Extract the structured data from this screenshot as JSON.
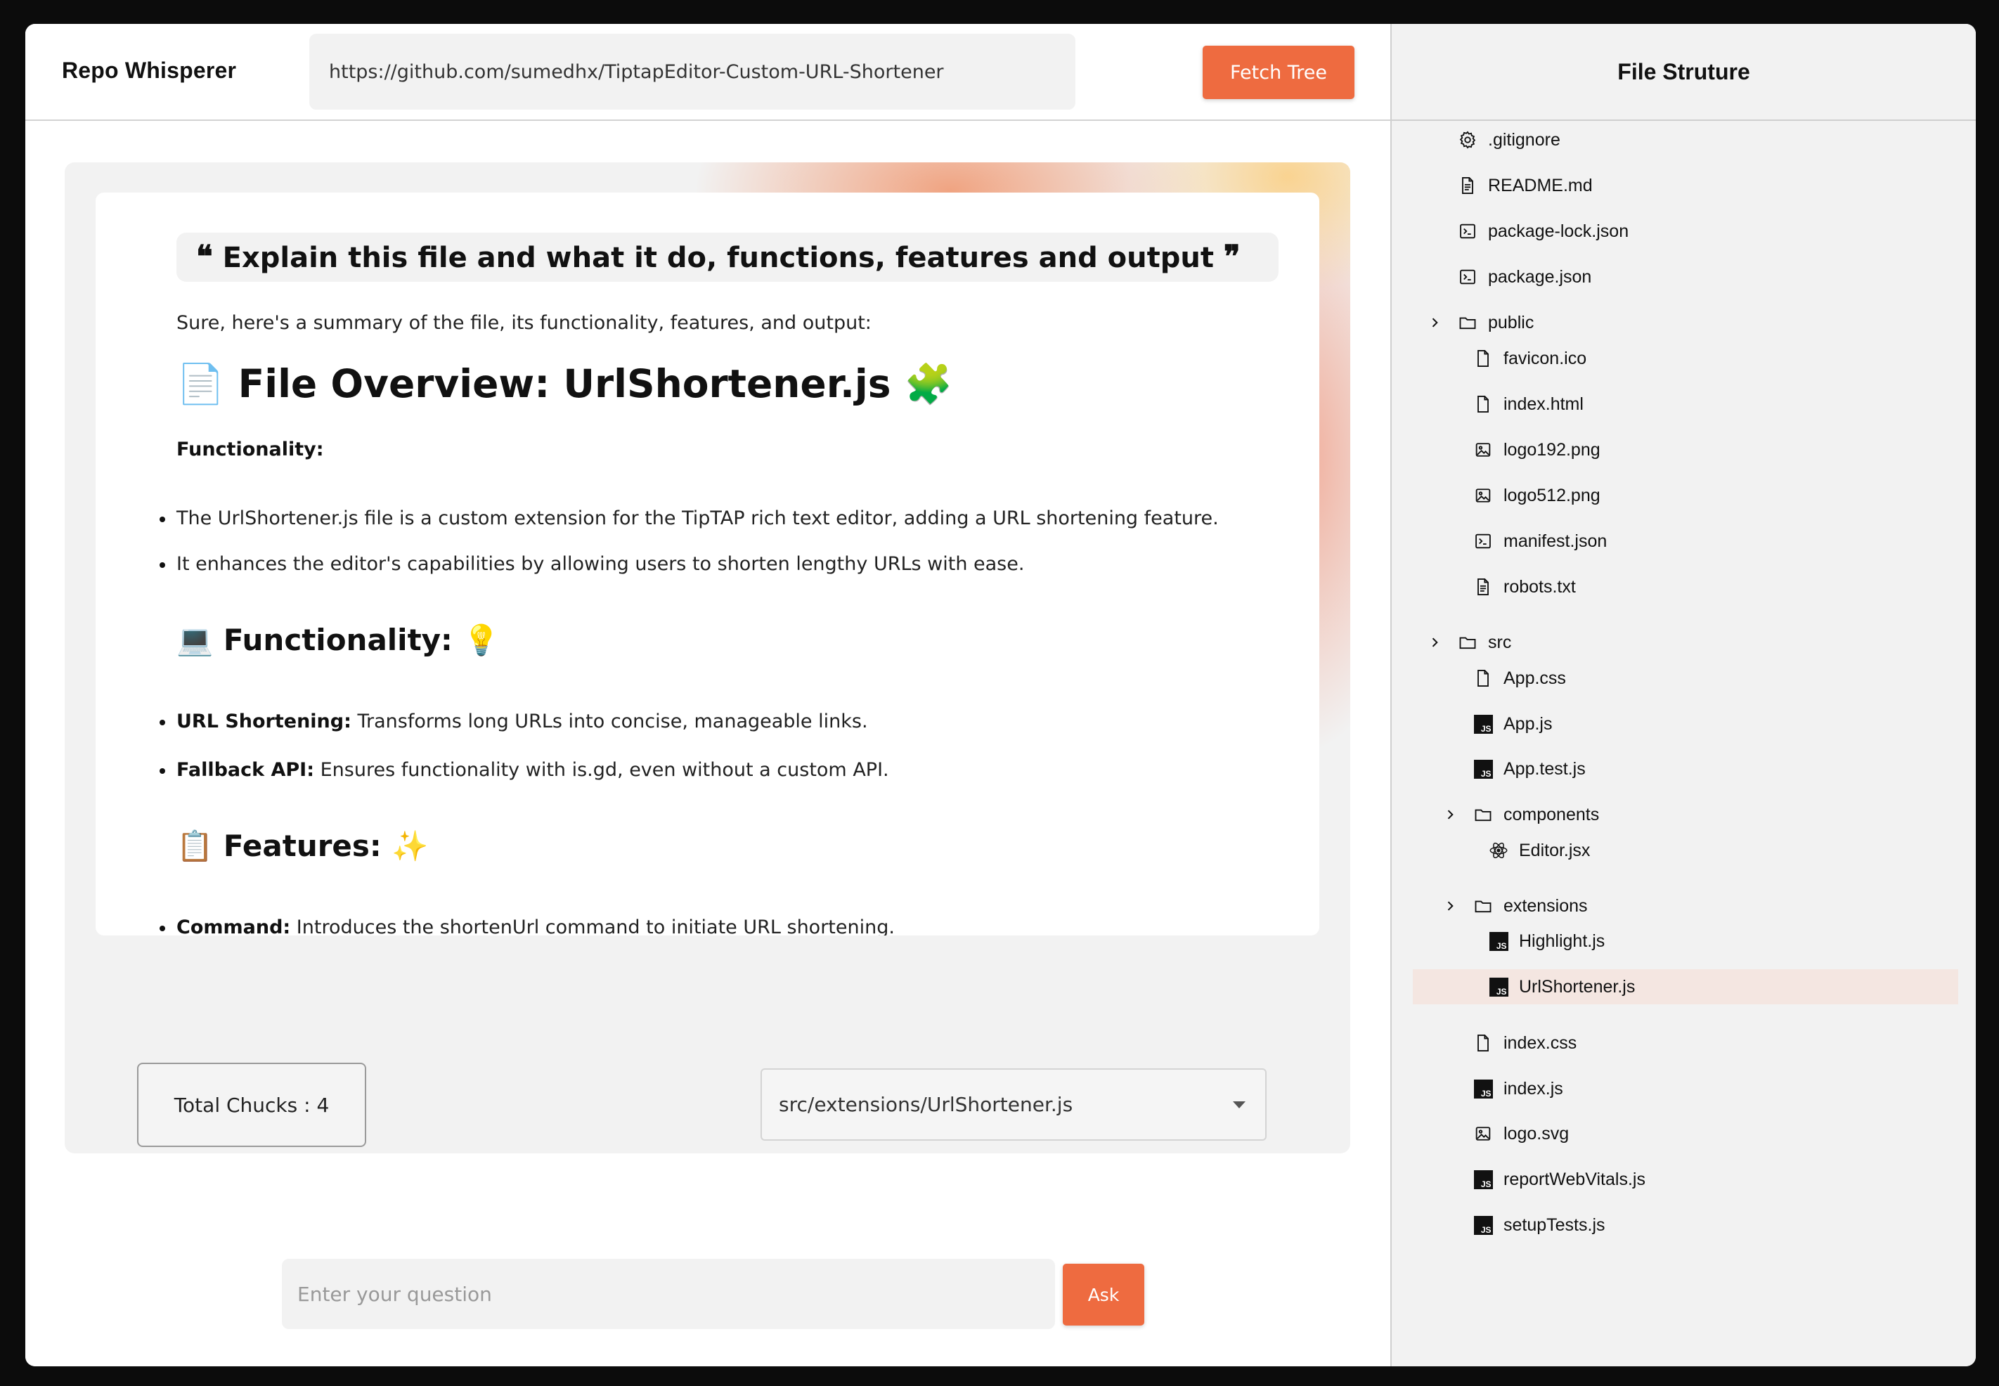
{
  "header": {
    "brand": "Repo Whisperer",
    "repo_url": "https://github.com/sumedhx/TiptapEditor-Custom-URL-Shortener",
    "fetch_label": "Fetch Tree"
  },
  "response": {
    "prompt": "Explain this file and what it do, functions, features and output",
    "intro": "Sure, here's a summary of the file, its functionality, features, and output:",
    "title": "File Overview: UrlShortener.js",
    "section1_heading": "Functionality:",
    "overview_bullets": [
      "The UrlShortener.js file is a custom extension for the TipTAP rich text editor, adding a URL shortening feature.",
      "It enhances the editor's capabilities by allowing users to shorten lengthy URLs with ease."
    ],
    "section2_heading": "Functionality:",
    "functionality_bullets": [
      {
        "term": "URL Shortening:",
        "text": "Transforms long URLs into concise, manageable links."
      },
      {
        "term": "Fallback API:",
        "text": "Ensures functionality with is.gd, even without a custom API."
      }
    ],
    "section3_heading": "Features:",
    "features_bullets": [
      {
        "term": "Command:",
        "text": "Introduces the shortenUrl command to initiate URL shortening."
      }
    ]
  },
  "footer": {
    "total_chunks": "Total Chucks : 4",
    "selected_file": "src/extensions/UrlShortener.js",
    "question_placeholder": "Enter your question",
    "ask_label": "Ask"
  },
  "sidebar": {
    "title": "File Struture",
    "items": [
      {
        "label": ".gitignore",
        "icon": "gear-icon"
      },
      {
        "label": "README.md",
        "icon": "document-icon"
      },
      {
        "label": "package-lock.json",
        "icon": "json-icon"
      },
      {
        "label": "package.json",
        "icon": "json-icon"
      },
      {
        "label": "public",
        "icon": "folder-icon"
      },
      {
        "label": "favicon.ico",
        "icon": "file-icon"
      },
      {
        "label": "index.html",
        "icon": "file-icon"
      },
      {
        "label": "logo192.png",
        "icon": "image-icon"
      },
      {
        "label": "logo512.png",
        "icon": "image-icon"
      },
      {
        "label": "manifest.json",
        "icon": "json-icon"
      },
      {
        "label": "robots.txt",
        "icon": "document-icon"
      },
      {
        "label": "src",
        "icon": "folder-icon"
      },
      {
        "label": "App.css",
        "icon": "file-icon"
      },
      {
        "label": "App.js",
        "icon": "js-icon"
      },
      {
        "label": "App.test.js",
        "icon": "js-icon"
      },
      {
        "label": "components",
        "icon": "folder-icon"
      },
      {
        "label": "Editor.jsx",
        "icon": "react-icon"
      },
      {
        "label": "extensions",
        "icon": "folder-icon"
      },
      {
        "label": "Highlight.js",
        "icon": "js-icon"
      },
      {
        "label": "UrlShortener.js",
        "icon": "js-icon"
      },
      {
        "label": "index.css",
        "icon": "file-icon"
      },
      {
        "label": "index.js",
        "icon": "js-icon"
      },
      {
        "label": "logo.svg",
        "icon": "image-icon"
      },
      {
        "label": "reportWebVitals.js",
        "icon": "js-icon"
      },
      {
        "label": "setupTests.js",
        "icon": "js-icon"
      }
    ]
  },
  "colors": {
    "accent": "#ee6b40",
    "selected_row": "#f4e6e1",
    "panel_bg": "#f2f2f2"
  }
}
